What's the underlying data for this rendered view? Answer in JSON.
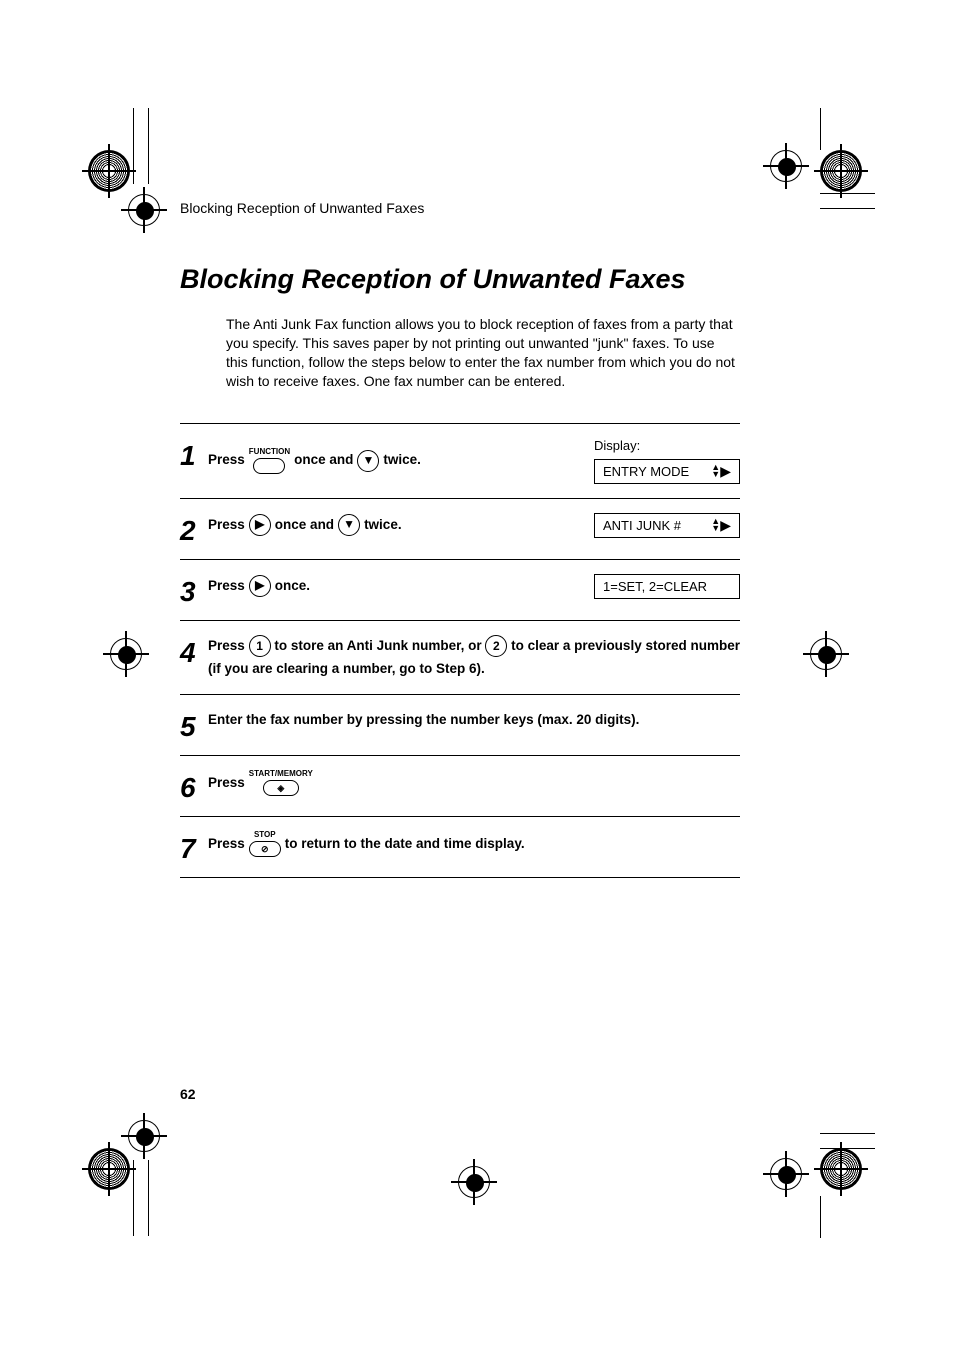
{
  "running_head": "Blocking Reception of Unwanted Faxes",
  "title": "Blocking Reception of Unwanted Faxes",
  "intro": "The Anti Junk Fax function allows you to block reception of faxes from a party that you specify. This saves paper by not printing out unwanted \"junk\" faxes. To use this function, follow the steps below to enter the fax number from which you do not wish to receive faxes. One fax number can be entered.",
  "display_header": "Display:",
  "steps": {
    "s1": {
      "num": "1",
      "t1": "Press",
      "key1_label": "FUNCTION",
      "t2": "once and",
      "key2_glyph": "▼",
      "t3": "twice.",
      "display": "ENTRY MODE"
    },
    "s2": {
      "num": "2",
      "t1": "Press",
      "key1_glyph": "▶",
      "t2": "once and",
      "key2_glyph": "▼",
      "t3": "twice.",
      "display": "ANTI JUNK #"
    },
    "s3": {
      "num": "3",
      "t1": "Press",
      "key1_glyph": "▶",
      "t2": "once.",
      "display": "1=SET, 2=CLEAR"
    },
    "s4": {
      "num": "4",
      "t1": "Press",
      "key1_glyph": "1",
      "t2": "to store an Anti Junk number, or",
      "key2_glyph": "2",
      "t3": "to clear a previously stored number (if you are clearing a number, go to Step 6)."
    },
    "s5": {
      "num": "5",
      "t1": "Enter the fax number by pressing the number keys (max. 20 digits)."
    },
    "s6": {
      "num": "6",
      "t1": "Press",
      "key1_label": "START/MEMORY",
      "key1_glyph": "◈"
    },
    "s7": {
      "num": "7",
      "t1": "Press",
      "key1_label": "STOP",
      "key1_glyph": "⊘",
      "t2": "to return to the date and time display."
    }
  },
  "page_number": "62"
}
